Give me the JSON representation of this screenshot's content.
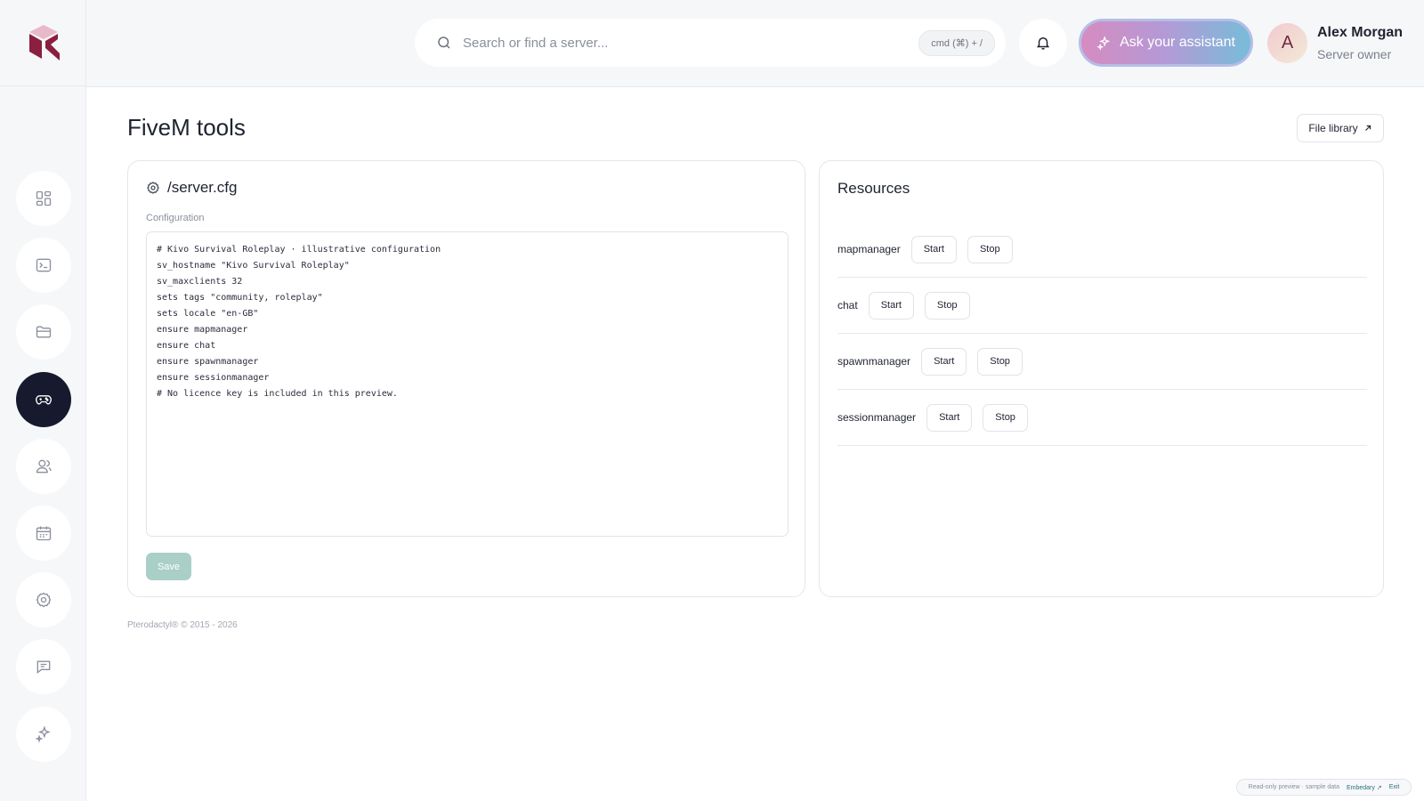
{
  "header": {
    "search_placeholder": "Search or find a server...",
    "search_shortcut": "cmd (⌘) + /",
    "assistant_label": "Ask your assistant",
    "user": {
      "initial": "A",
      "name": "Alex Morgan",
      "role": "Server owner"
    }
  },
  "sidebar": {
    "items": [
      {
        "icon": "dashboard-icon",
        "active": false
      },
      {
        "icon": "console-icon",
        "active": false
      },
      {
        "icon": "folder-icon",
        "active": false
      },
      {
        "icon": "gamepad-icon",
        "active": true
      },
      {
        "icon": "users-icon",
        "active": false
      },
      {
        "icon": "calendar-icon",
        "active": false
      },
      {
        "icon": "settings-icon",
        "active": false
      },
      {
        "icon": "chat-icon",
        "active": false
      },
      {
        "icon": "sparkle-icon",
        "active": false
      }
    ]
  },
  "main": {
    "title": "FiveM tools",
    "file_library_label": "File library",
    "config": {
      "title": "/server.cfg",
      "label": "Configuration",
      "content": "# Kivo Survival Roleplay · illustrative configuration\nsv_hostname \"Kivo Survival Roleplay\"\nsv_maxclients 32\nsets tags \"community, roleplay\"\nsets locale \"en-GB\"\nensure mapmanager\nensure chat\nensure spawnmanager\nensure sessionmanager\n# No licence key is included in this preview.",
      "save_label": "Save"
    },
    "resources": {
      "title": "Resources",
      "start_label": "Start",
      "stop_label": "Stop",
      "items": [
        {
          "name": "mapmanager"
        },
        {
          "name": "chat"
        },
        {
          "name": "spawnmanager"
        },
        {
          "name": "sessionmanager"
        }
      ]
    }
  },
  "footer": {
    "copyright": "Pterodactyl® © 2015 - 2026"
  },
  "preview_badge": {
    "text": "Read-only preview · sample data",
    "link": "Embedary ↗",
    "exit": "Exit"
  },
  "colors": {
    "accent_dark": "#171a2e",
    "save_disabled": "#a9cfc6",
    "assistant_gradient_start": "#d68bc0",
    "assistant_gradient_end": "#78bcd8"
  }
}
